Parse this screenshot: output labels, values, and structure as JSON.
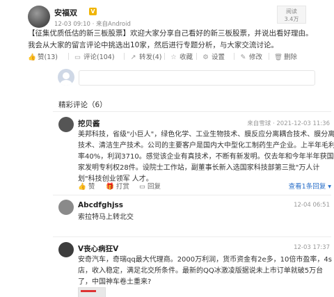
{
  "post": {
    "author": "安福双",
    "vip_badge": "V",
    "meta": "12-03 09:10 · 来自Android",
    "read_label": "阅读",
    "read_count": "3.4万",
    "body": "【征集优质低估的新三板股票】欢迎大家分享自己看好的新三板股票，并说出看好理由。我会从大家的留言评论中挑选出10家，然后进行专题分析，与大家交流讨论。"
  },
  "actions": {
    "like": "赞(13)",
    "comment": "评论(104)",
    "share": "转发(4)",
    "favorite": "收藏",
    "settings": "设置",
    "edit": "修改",
    "delete": "删除"
  },
  "comment_box": {
    "placeholder": ""
  },
  "comments_section": {
    "title": "精彩评论（6）"
  },
  "comments": [
    {
      "name": "挖贝酱",
      "meta": "来自雪球 · 2021-12-03 11:36",
      "body": "美邦科技，省级\"小巨人\"，绿色化学、工业生物技术、膜反应分离耦合技术、膜分离技术、清洁生产技术。公司的主要客户是国内大中型化工制药生产企业。上半年毛利率40%，利润3710。感觉该企业有真技术，不断有新发明。仅去年和今年半年获国家发明专利权28件。设院士工作站，副董事长新入选国家科技部第三批\"万人计划\"科技创业领军 人才。",
      "like": "赞",
      "share": "打赏",
      "reply": "回复",
      "view_replies": "查看1条回复 ▾"
    },
    {
      "name": "Abcdfghjss",
      "meta": "12-04 06:51",
      "body": "索拉特马上转北交"
    },
    {
      "name": "V丧心病狂V",
      "meta": "12-03 17:37",
      "body": "安奇汽车，奇瑞qq最大代理商。2000万利润，货币资金有2e多，10倍市盈率，4s店，收入稳定，满足北交所条件。最新的QQ冰激凌版据说未上市订单就破5万台了，中国神车卷土重来?"
    }
  ]
}
